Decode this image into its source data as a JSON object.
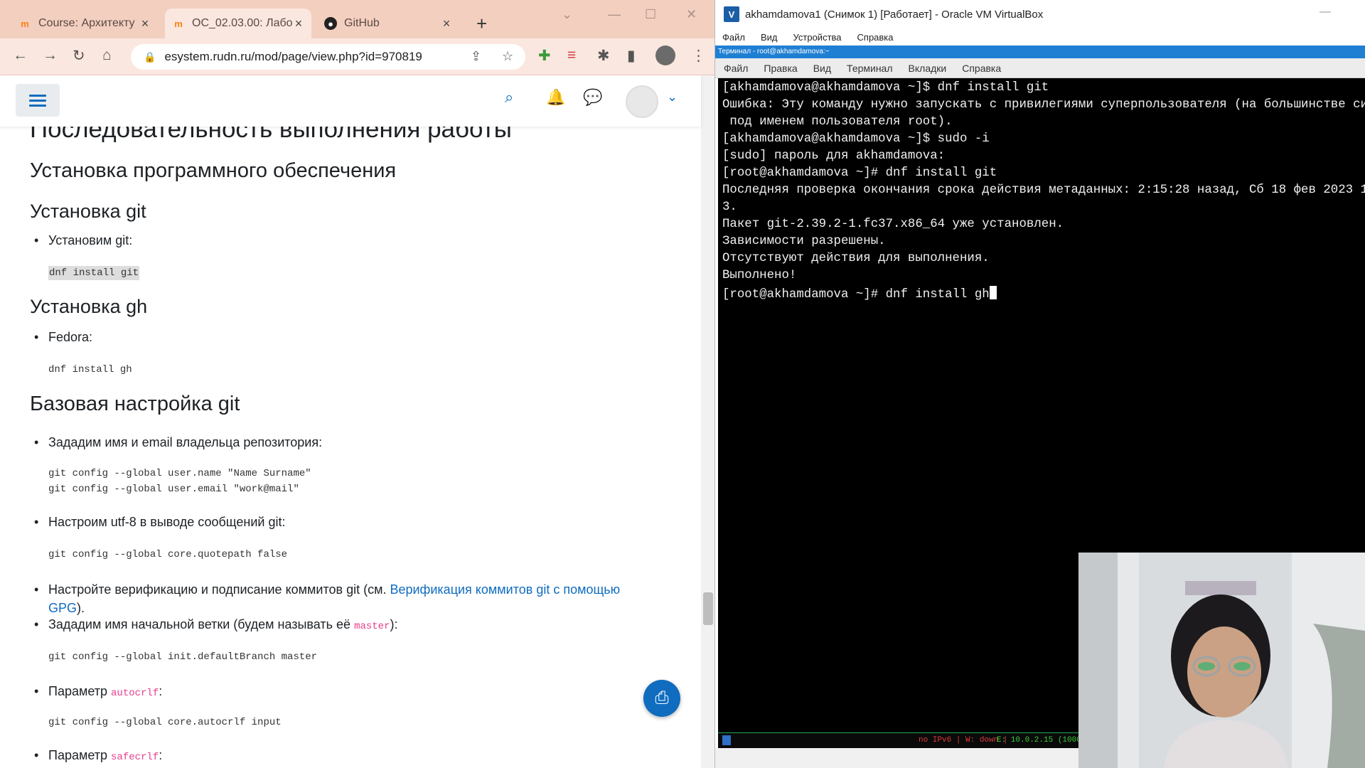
{
  "browser": {
    "tabs": [
      {
        "title": "Course: Архитекту",
        "favicon": "moodle-icon"
      },
      {
        "title": "ОС_02.03.00: Лабо",
        "favicon": "moodle-icon"
      },
      {
        "title": "GitHub",
        "favicon": "github-icon"
      }
    ],
    "new_tab": "+",
    "url": "esystem.rudn.ru/mod/page/view.php?id=970819"
  },
  "page": {
    "heading_main": "Последовательность выполнения работы",
    "heading_install": "Установка программного обеспечения",
    "heading_git": "Установка git",
    "li_install_git": "Установим git:",
    "code_install_git": "dnf install git",
    "heading_gh": "Установка gh",
    "li_fedora": "Fedora:",
    "code_install_gh": "dnf install gh",
    "heading_base": "Базовая настройка git",
    "li_name_email": "Зададим имя и email владельца репозитория:",
    "code_name": "git config --global user.name \"Name Surname\"",
    "code_email": "git config --global user.email \"work@mail\"",
    "li_utf8": "Настроим utf-8 в выводе сообщений git:",
    "code_quotepath": "git config --global core.quotepath false",
    "li_verify_prefix": "Настройте верификацию и подписание коммитов git (см. ",
    "li_verify_link1": "Верификация коммитов git с помощью",
    "li_verify_link2": "GPG",
    "li_verify_suffix": ").",
    "li_branch_prefix": "Зададим имя начальной ветки (будем называть её ",
    "li_branch_kw": "master",
    "li_branch_suffix": "):",
    "code_branch": "git config --global init.defaultBranch master",
    "li_autocrlf_prefix": "Параметр ",
    "li_autocrlf_kw": "autocrlf",
    "li_autocrlf_suffix": ":",
    "code_autocrlf": "git config --global core.autocrlf input",
    "li_safecrlf_prefix": "Параметр ",
    "li_safecrlf_kw": "safecrlf",
    "li_safecrlf_suffix": ":"
  },
  "vbox": {
    "title": "akhamdamova1 (Снимок 1) [Работает] - Oracle VM VirtualBox",
    "menu": [
      "Файл",
      "Вид",
      "Устройства",
      "Справка"
    ],
    "gtk_title": "Терминал - root@akhamdamova:~",
    "term_menu": [
      "Файл",
      "Правка",
      "Вид",
      "Терминал",
      "Вкладки",
      "Справка"
    ],
    "terminal_lines": [
      "[akhamdamova@akhamdamova ~]$ dnf install git",
      "Ошибка: Эту команду нужно запускать с привилегиями суперпользователя (на большинстве си",
      " под именем пользователя root).",
      "[akhamdamova@akhamdamova ~]$ sudo -i",
      "[sudo] пароль для akhamdamova:",
      "[root@akhamdamova ~]# dnf install git",
      "Последняя проверка окончания срока действия метаданных: 2:15:28 назад, Сб 18 фев 2023 1",
      "3.",
      "Пакет git-2.39.2-1.fc37.x86_64 уже установлен.",
      "Зависимости разрешены.",
      "Отсутствуют действия для выполнения.",
      "Выполнено!"
    ],
    "prompt_current": "[root@akhamdamova ~]# dnf install gh",
    "status_red": "no IPv6 | W: down |",
    "status_green": "E: 10.0.2.15 (1000",
    "status_block": "1"
  },
  "colors": {
    "tabstrip": "#f3cfc0",
    "toolbar": "#fae7df",
    "moodle_blue": "#0f6cbf",
    "terminal_bg": "#000000"
  }
}
